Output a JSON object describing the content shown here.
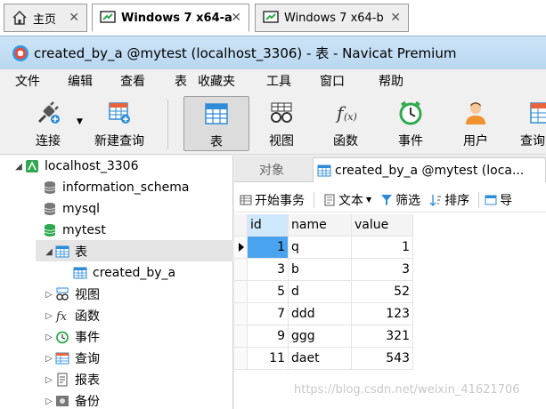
{
  "vm_tabs": [
    {
      "label": "主页",
      "icon": "home-icon"
    },
    {
      "label": "Windows 7 x64-a",
      "icon": "vm-icon"
    },
    {
      "label": "Windows 7 x64-b",
      "icon": "vm-icon"
    }
  ],
  "close_glyph": "✕",
  "window_title": "created_by_a @mytest (localhost_3306) - 表 - Navicat Premium",
  "menu": [
    "文件",
    "编辑",
    "查看",
    "表",
    "收藏夹",
    "工具",
    "窗口",
    "帮助"
  ],
  "toolbar": [
    {
      "label": "连接",
      "icon": "plug-icon"
    },
    {
      "label": "新建查询",
      "icon": "new-query-icon"
    },
    {
      "label": "表",
      "icon": "table-icon"
    },
    {
      "label": "视图",
      "icon": "view-glasses-icon"
    },
    {
      "label": "函数",
      "icon": "function-icon"
    },
    {
      "label": "事件",
      "icon": "clock-icon"
    },
    {
      "label": "用户",
      "icon": "user-icon"
    },
    {
      "label": "查询",
      "icon": "query-icon"
    }
  ],
  "tree": {
    "connection": "localhost_3306",
    "databases": [
      "information_schema",
      "mysql",
      "mytest"
    ],
    "tables_group": "表",
    "table": "created_by_a",
    "groups": [
      "视图",
      "函数",
      "事件",
      "查询",
      "报表",
      "备份"
    ]
  },
  "tabs": {
    "objects": "对象",
    "active": "created_by_a @mytest (loca..."
  },
  "subtoolbar": {
    "begin_tx": "开始事务",
    "text": "文本",
    "filter": "筛选",
    "sort": "排序",
    "import": "导"
  },
  "grid": {
    "columns": [
      "id",
      "name",
      "value"
    ],
    "rows": [
      [
        "1",
        "q",
        "1"
      ],
      [
        "3",
        "b",
        "3"
      ],
      [
        "5",
        "d",
        "52"
      ],
      [
        "7",
        "ddd",
        "123"
      ],
      [
        "9",
        "ggg",
        "321"
      ],
      [
        "11",
        "daet",
        "543"
      ]
    ]
  },
  "watermark": "https://blog.csdn.net/weixin_41621706",
  "colors": {
    "accent": "#2e8bd6",
    "selected_cell": "#4aa3ee",
    "db_green": "#2fa84f"
  }
}
